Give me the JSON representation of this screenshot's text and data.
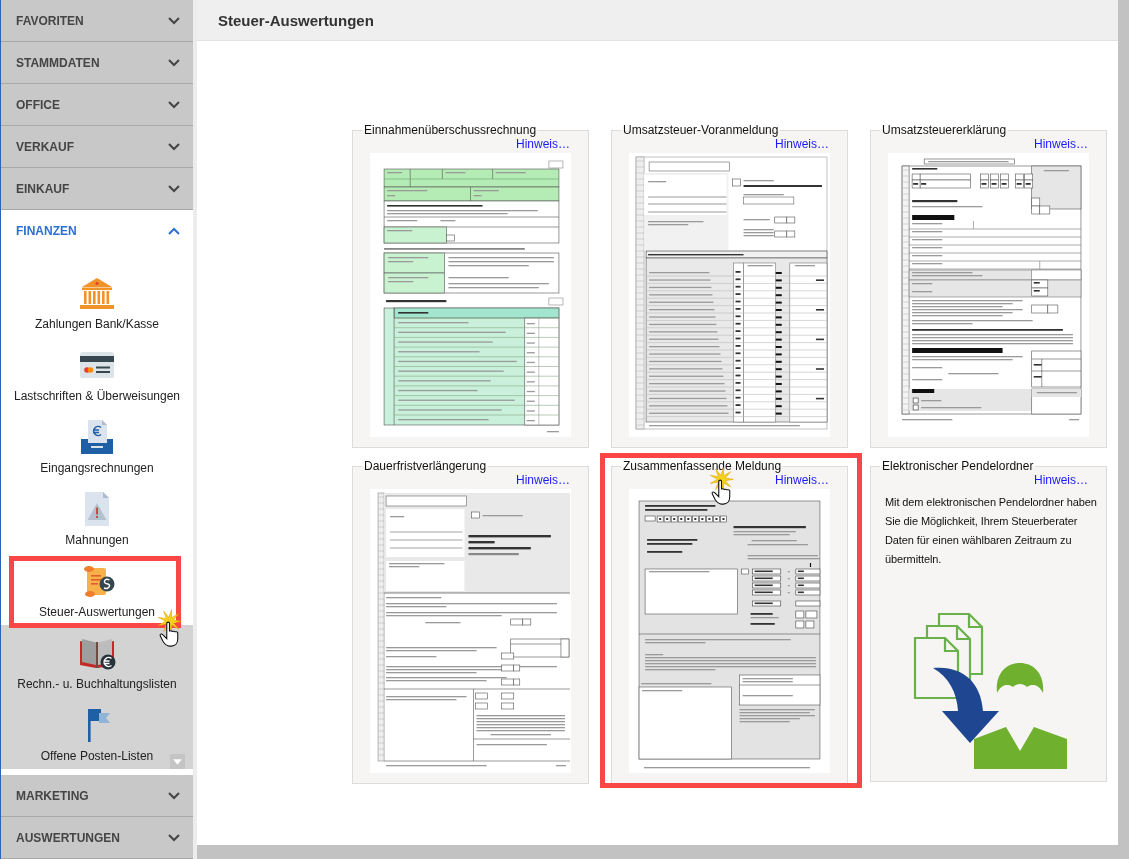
{
  "sidebar": {
    "sections": [
      {
        "label": "FAVORITEN",
        "expanded": false
      },
      {
        "label": "STAMMDATEN",
        "expanded": false
      },
      {
        "label": "OFFICE",
        "expanded": false
      },
      {
        "label": "VERKAUF",
        "expanded": false
      },
      {
        "label": "EINKAUF",
        "expanded": false
      },
      {
        "label": "FINANZEN",
        "expanded": true,
        "items": [
          {
            "label": "Zahlungen Bank/Kasse",
            "shaded": false,
            "highlighted": false,
            "cursor": false
          },
          {
            "label": "Lastschriften & Überweisungen",
            "shaded": false,
            "highlighted": false,
            "cursor": false
          },
          {
            "label": "Eingangsrechnungen",
            "shaded": false,
            "highlighted": false,
            "cursor": false
          },
          {
            "label": "Mahnungen",
            "shaded": false,
            "highlighted": false,
            "cursor": false
          },
          {
            "label": "Steuer-Auswertungen",
            "shaded": false,
            "highlighted": true,
            "cursor": true
          },
          {
            "label": "Rechn.- u. Buchhaltungslisten",
            "shaded": true,
            "highlighted": false,
            "cursor": false
          },
          {
            "label": "Offene Posten-Listen",
            "shaded": true,
            "highlighted": false,
            "cursor": false
          }
        ]
      },
      {
        "label": "MARKETING",
        "expanded": false
      },
      {
        "label": "AUSWERTUNGEN",
        "expanded": false
      }
    ]
  },
  "main": {
    "title": "Steuer-Auswertungen",
    "cards": [
      {
        "kind": "preview",
        "title": "Einnahmenüberschussrechnung",
        "link": "Hinweis…",
        "highlighted": false,
        "cursor": false
      },
      {
        "kind": "preview",
        "title": "Umsatzsteuer-Voranmeldung",
        "link": "Hinweis…",
        "highlighted": false,
        "cursor": false
      },
      {
        "kind": "preview",
        "title": "Umsatzsteuererklärung",
        "link": "Hinweis…",
        "highlighted": false,
        "cursor": false
      },
      {
        "kind": "preview",
        "title": "Dauerfristverlängerung",
        "link": "Hinweis…",
        "highlighted": false,
        "cursor": false
      },
      {
        "kind": "preview",
        "title": "Zusammenfassende Meldung",
        "link": "Hinweis…",
        "highlighted": true,
        "cursor": true
      },
      {
        "kind": "info",
        "title": "Elektronischer Pendelordner",
        "link": "Hinweis…",
        "description": "Mit dem elektronischen Pendelordner haben Sie die Möglichkeit, Ihrem Steuerberater Daten für einen wählbaren Zeitraum zu übermitteln.",
        "highlighted": false,
        "cursor": false
      }
    ]
  }
}
